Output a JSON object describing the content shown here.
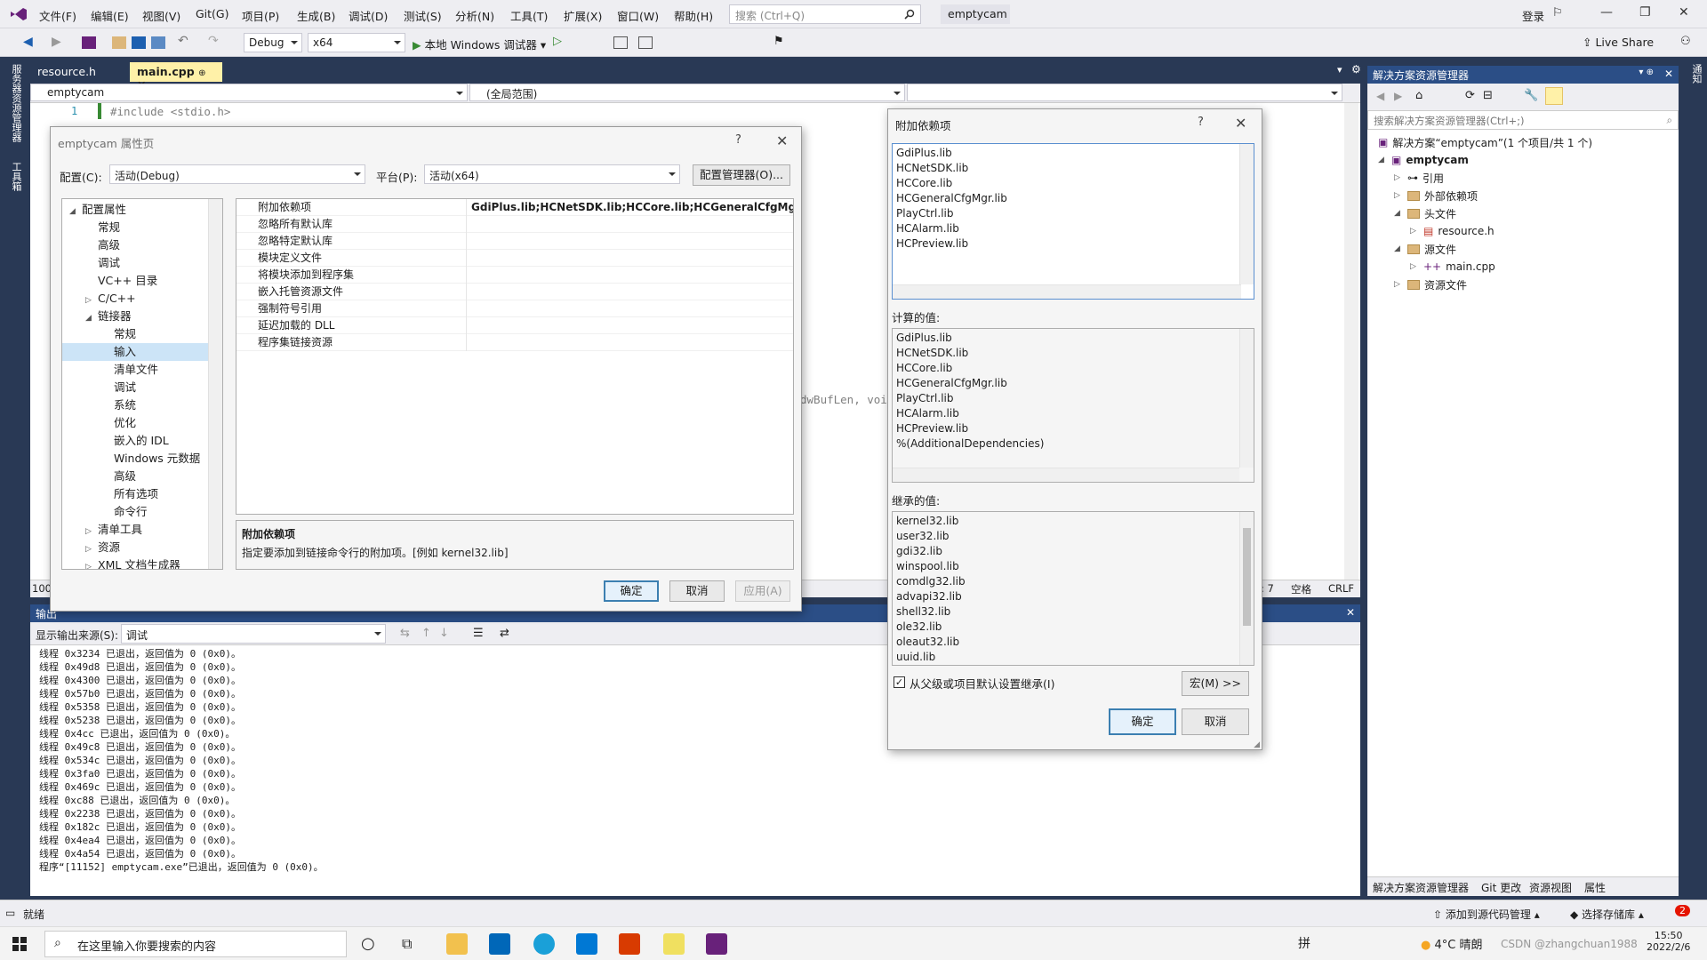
{
  "titlebar": {
    "menus": [
      "文件(F)",
      "编辑(E)",
      "视图(V)",
      "Git(G)",
      "项目(P)",
      "生成(B)",
      "调试(D)",
      "测试(S)",
      "分析(N)",
      "工具(T)",
      "扩展(X)",
      "窗口(W)",
      "帮助(H)"
    ],
    "search_placeholder": "搜索 (Ctrl+Q)",
    "solution_name": "emptycam",
    "login": "登录"
  },
  "toolbar": {
    "config": "Debug",
    "platform": "x64",
    "run_label": "本地 Windows 调试器",
    "live_share": "Live Share"
  },
  "left_strip": {
    "items": [
      "服务器资源管理器",
      "工具箱"
    ]
  },
  "doc_tabs": [
    "resource.h",
    "main.cpp"
  ],
  "editor": {
    "project_combo": "emptycam",
    "scope_combo": "(全局范围)",
    "line_number": "1",
    "line_code": "#include <stdio.h>",
    "fragment": "dwBufLen, voi",
    "zoom": "100",
    "col": "7",
    "spaces": "空格",
    "eol": "CRLF"
  },
  "output": {
    "title": "输出",
    "source_label": "显示输出来源(S):",
    "source_value": "调试",
    "lines": [
      "线程 0x3234 已退出，返回值为 0 (0x0)。",
      "线程 0x49d8 已退出，返回值为 0 (0x0)。",
      "线程 0x4300 已退出，返回值为 0 (0x0)。",
      "线程 0x57b0 已退出，返回值为 0 (0x0)。",
      "线程 0x5358 已退出，返回值为 0 (0x0)。",
      "线程 0x5238 已退出，返回值为 0 (0x0)。",
      "线程 0x4cc 已退出，返回值为 0 (0x0)。",
      "线程 0x49c8 已退出，返回值为 0 (0x0)。",
      "线程 0x534c 已退出，返回值为 0 (0x0)。",
      "线程 0x3fa0 已退出，返回值为 0 (0x0)。",
      "线程 0x469c 已退出，返回值为 0 (0x0)。",
      "线程 0xc88 已退出，返回值为 0 (0x0)。",
      "线程 0x2238 已退出，返回值为 0 (0x0)。",
      "线程 0x182c 已退出，返回值为 0 (0x0)。",
      "线程 0x4ea4 已退出，返回值为 0 (0x0)。",
      "线程 0x4a54 已退出，返回值为 0 (0x0)。",
      "程序“[11152] emptycam.exe”已退出，返回值为 0 (0x0)。"
    ]
  },
  "solution_explorer": {
    "title": "解决方案资源管理器",
    "search_placeholder": "搜索解决方案资源管理器(Ctrl+;)",
    "solution_label": "解决方案“emptycam”(1 个项目/共 1 个)",
    "project": "emptycam",
    "references": "引用",
    "external_deps": "外部依赖项",
    "header_files": "头文件",
    "resource_file": "resource.h",
    "source_files": "源文件",
    "main_file": "main.cpp",
    "resource_files": "资源文件",
    "bottom_tabs": [
      "解决方案资源管理器",
      "Git 更改",
      "资源视图",
      "属性"
    ]
  },
  "statusbar": {
    "ready": "就绪",
    "add_source": "添加到源代码管理",
    "select_repo": "选择存储库",
    "notifications": "2"
  },
  "taskbar": {
    "search_placeholder": "在这里输入你要搜索的内容",
    "weather": "4°C 晴朗",
    "time": "15:50",
    "date": "2022/2/6",
    "watermark": "CSDN @zhangchuan1988",
    "ime": "拼"
  },
  "prop_dialog": {
    "title": "emptycam 属性页",
    "config_label": "配置(C):",
    "config_value": "活动(Debug)",
    "platform_label": "平台(P):",
    "platform_value": "活动(x64)",
    "config_manager": "配置管理器(O)...",
    "tree": [
      {
        "label": "配置属性",
        "indent": 0,
        "caret": "◢"
      },
      {
        "label": "常规",
        "indent": 1,
        "caret": ""
      },
      {
        "label": "高级",
        "indent": 1,
        "caret": ""
      },
      {
        "label": "调试",
        "indent": 1,
        "caret": ""
      },
      {
        "label": "VC++ 目录",
        "indent": 1,
        "caret": ""
      },
      {
        "label": "C/C++",
        "indent": 1,
        "caret": "▷"
      },
      {
        "label": "链接器",
        "indent": 1,
        "caret": "◢"
      },
      {
        "label": "常规",
        "indent": 2,
        "caret": ""
      },
      {
        "label": "输入",
        "indent": 2,
        "caret": "",
        "selected": true
      },
      {
        "label": "清单文件",
        "indent": 2,
        "caret": ""
      },
      {
        "label": "调试",
        "indent": 2,
        "caret": ""
      },
      {
        "label": "系统",
        "indent": 2,
        "caret": ""
      },
      {
        "label": "优化",
        "indent": 2,
        "caret": ""
      },
      {
        "label": "嵌入的 IDL",
        "indent": 2,
        "caret": ""
      },
      {
        "label": "Windows 元数据",
        "indent": 2,
        "caret": ""
      },
      {
        "label": "高级",
        "indent": 2,
        "caret": ""
      },
      {
        "label": "所有选项",
        "indent": 2,
        "caret": ""
      },
      {
        "label": "命令行",
        "indent": 2,
        "caret": ""
      },
      {
        "label": "清单工具",
        "indent": 1,
        "caret": "▷"
      },
      {
        "label": "资源",
        "indent": 1,
        "caret": "▷"
      },
      {
        "label": "XML 文档生成器",
        "indent": 1,
        "caret": "▷"
      }
    ],
    "grid": [
      {
        "key": "附加依赖项",
        "value": "GdiPlus.lib;HCNetSDK.lib;HCCore.lib;HCGeneralCfgMgr.lib;H"
      },
      {
        "key": "忽略所有默认库",
        "value": ""
      },
      {
        "key": "忽略特定默认库",
        "value": ""
      },
      {
        "key": "模块定义文件",
        "value": ""
      },
      {
        "key": "将模块添加到程序集",
        "value": ""
      },
      {
        "key": "嵌入托管资源文件",
        "value": ""
      },
      {
        "key": "强制符号引用",
        "value": ""
      },
      {
        "key": "延迟加载的 DLL",
        "value": ""
      },
      {
        "key": "程序集链接资源",
        "value": ""
      }
    ],
    "desc_title": "附加依赖项",
    "desc_text": "指定要添加到链接命令行的附加项。[例如 kernel32.lib]",
    "ok": "确定",
    "cancel": "取消",
    "apply": "应用(A)"
  },
  "dep_dialog": {
    "title": "附加依赖项",
    "help": "?",
    "editable": [
      "GdiPlus.lib",
      "HCNetSDK.lib",
      "HCCore.lib",
      "HCGeneralCfgMgr.lib",
      "PlayCtrl.lib",
      "HCAlarm.lib",
      "HCPreview.lib"
    ],
    "computed_label": "计算的值:",
    "computed": [
      "GdiPlus.lib",
      "HCNetSDK.lib",
      "HCCore.lib",
      "HCGeneralCfgMgr.lib",
      "PlayCtrl.lib",
      "HCAlarm.lib",
      "HCPreview.lib",
      "%(AdditionalDependencies)"
    ],
    "inherited_label": "继承的值:",
    "inherited": [
      "kernel32.lib",
      "user32.lib",
      "gdi32.lib",
      "winspool.lib",
      "comdlg32.lib",
      "advapi32.lib",
      "shell32.lib",
      "ole32.lib",
      "oleaut32.lib",
      "uuid.lib"
    ],
    "inherit_checkbox": "从父级或项目默认设置继承(I)",
    "macro_button": "宏(M) >>",
    "ok": "确定",
    "cancel": "取消"
  }
}
